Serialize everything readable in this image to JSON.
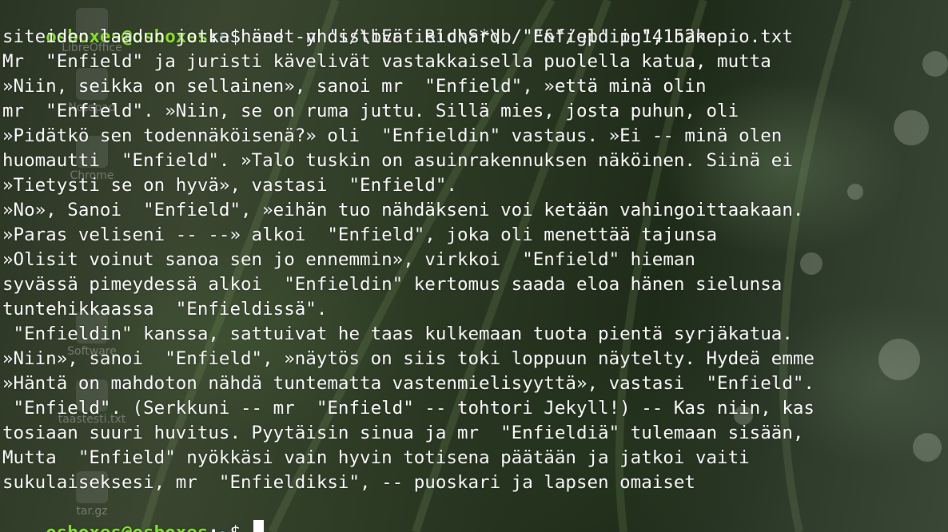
{
  "theme": {
    "prompt_user_color": "#8ae234",
    "prompt_path_color": "#729fcf",
    "text_color": "#ffffff"
  },
  "desktop": {
    "icons": [
      {
        "label": "LibreOffice",
        "icon": "libreoffice-icon"
      },
      {
        "label": "Notepad",
        "icon": "notepad-icon"
      },
      {
        "label": "Chrome",
        "icon": "chrome-icon"
      },
      {
        "label": "Software",
        "icon": "software-icon"
      },
      {
        "label": "taastesti.txt",
        "icon": "text-file-icon"
      },
      {
        "label": "tar.gz",
        "icon": "archive-icon"
      }
    ]
  },
  "terminal": {
    "prompt": {
      "user_host": "osboxes@osboxes",
      "colon": ":",
      "path": "~",
      "symbol": "$ "
    },
    "command": "sed -n 's/\\bEnfield\\S*\\b/ \"&\"/gp' pg14152kopio.txt",
    "output_lines": [
      "siteiden laadun jotka hänet yhdistivät Richard  \"Enfieldiin\", hänen",
      "Mr  \"Enfield\" ja juristi kävelivät vastakkaisella puolella katua, mutta",
      "»Niin, seikka on sellainen», sanoi mr  \"Enfield\", »että minä olin",
      "mr  \"Enfield\". »Niin, se on ruma juttu. Sillä mies, josta puhun, oli",
      "»Pidätkö sen todennäköisenä?» oli  \"Enfieldin\" vastaus. »Ei -- minä olen",
      "huomautti  \"Enfield\". »Talo tuskin on asuinrakennuksen näköinen. Siinä ei",
      "»Tietysti se on hyvä», vastasi  \"Enfield\".",
      "»No», Sanoi  \"Enfield\", »eihän tuo nähdäkseni voi ketään vahingoittaakaan.",
      "»Paras veliseni -- --» alkoi  \"Enfield\", joka oli menettää tajunsa",
      "»Olisit voinut sanoa sen jo ennemmin», virkkoi  \"Enfield\" hieman",
      "syvässä pimeydessä alkoi  \"Enfieldin\" kertomus saada eloa hänen sielunsa",
      "tuntehikkaassa  \"Enfieldissä\".",
      " \"Enfieldin\" kanssa, sattuivat he taas kulkemaan tuota pientä syrjäkatua.",
      "»Niin», sanoi  \"Enfield\", »näytös on siis toki loppuun näytelty. Hydeä emme",
      "»Häntä on mahdoton nähdä tuntematta vastenmielisyyttä», vastasi  \"Enfield\".",
      " \"Enfield\". (Serkkuni -- mr  \"Enfield\" -- tohtori Jekyll!) -- Kas niin, kas",
      "tosiaan suuri huvitus. Pyytäisin sinua ja mr  \"Enfieldiä\" tulemaan sisään,",
      "Mutta  \"Enfield\" nyökkäsi vain hyvin totisena päätään ja jatkoi vaiti",
      "sukulaiseksesi, mr  \"Enfieldiksi\", -- puoskari ja lapsen omaiset"
    ],
    "final_prompt_input": ""
  }
}
